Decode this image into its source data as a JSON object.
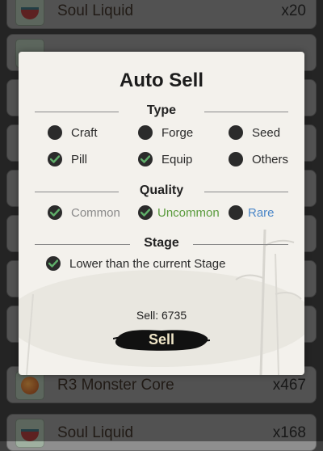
{
  "inventory": {
    "rows": [
      {
        "name": "Soul Liquid",
        "qty": "x20"
      },
      {
        "name": "R3 Monster Core",
        "qty": "x467"
      },
      {
        "name": "Soul Liquid",
        "qty": "x168"
      }
    ]
  },
  "modal": {
    "title": "Auto Sell",
    "type": {
      "heading": "Type",
      "options": [
        {
          "label": "Craft",
          "checked": false
        },
        {
          "label": "Forge",
          "checked": false
        },
        {
          "label": "Seed",
          "checked": false
        },
        {
          "label": "Pill",
          "checked": true
        },
        {
          "label": "Equip",
          "checked": true
        },
        {
          "label": "Others",
          "checked": false
        }
      ]
    },
    "quality": {
      "heading": "Quality",
      "options": [
        {
          "label": "Common",
          "checked": true,
          "color": "#8a8a8a"
        },
        {
          "label": "Uncommon",
          "checked": true,
          "color": "#5a9b3c"
        },
        {
          "label": "Rare",
          "checked": false,
          "color": "#4a86c8"
        }
      ]
    },
    "stage": {
      "heading": "Stage",
      "option": {
        "label": "Lower than the current Stage",
        "checked": true
      }
    },
    "sell_count": "Sell: 6735",
    "sell_button": "Sell"
  },
  "colors": {
    "check_icon": "#5fae6a",
    "checkbox_fill": "#2b2b2b",
    "button_ink": "#111111"
  }
}
